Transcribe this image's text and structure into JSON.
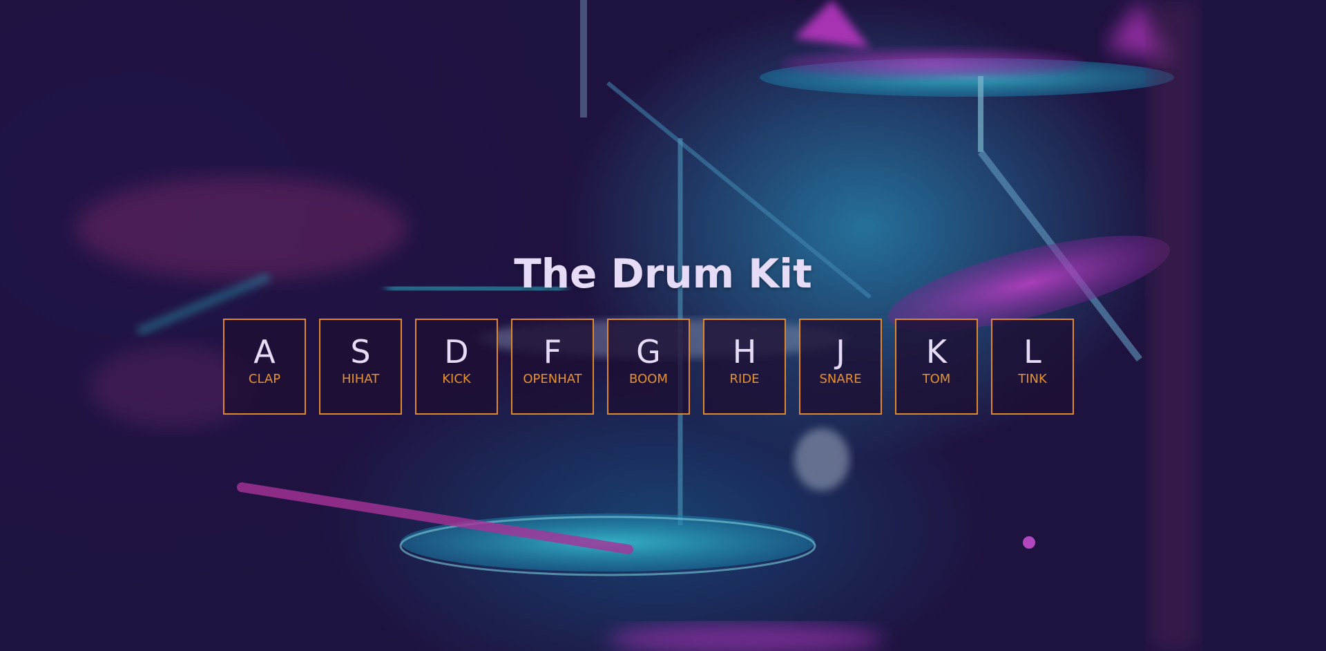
{
  "page": {
    "title": "The Drum Kit"
  },
  "keys": [
    {
      "key": "A",
      "sound": "CLAP"
    },
    {
      "key": "S",
      "sound": "HIHAT"
    },
    {
      "key": "D",
      "sound": "KICK"
    },
    {
      "key": "F",
      "sound": "OPENHAT"
    },
    {
      "key": "G",
      "sound": "BOOM"
    },
    {
      "key": "H",
      "sound": "RIDE"
    },
    {
      "key": "J",
      "sound": "SNARE"
    },
    {
      "key": "K",
      "sound": "TOM"
    },
    {
      "key": "L",
      "sound": "TINK"
    }
  ],
  "colors": {
    "background": "#221440",
    "title": "#e7dcf7",
    "key_border": "#e0892c",
    "sound_label": "#e8922e",
    "accent_cyan": "#2ad4e0",
    "accent_magenta": "#d43ad8"
  }
}
